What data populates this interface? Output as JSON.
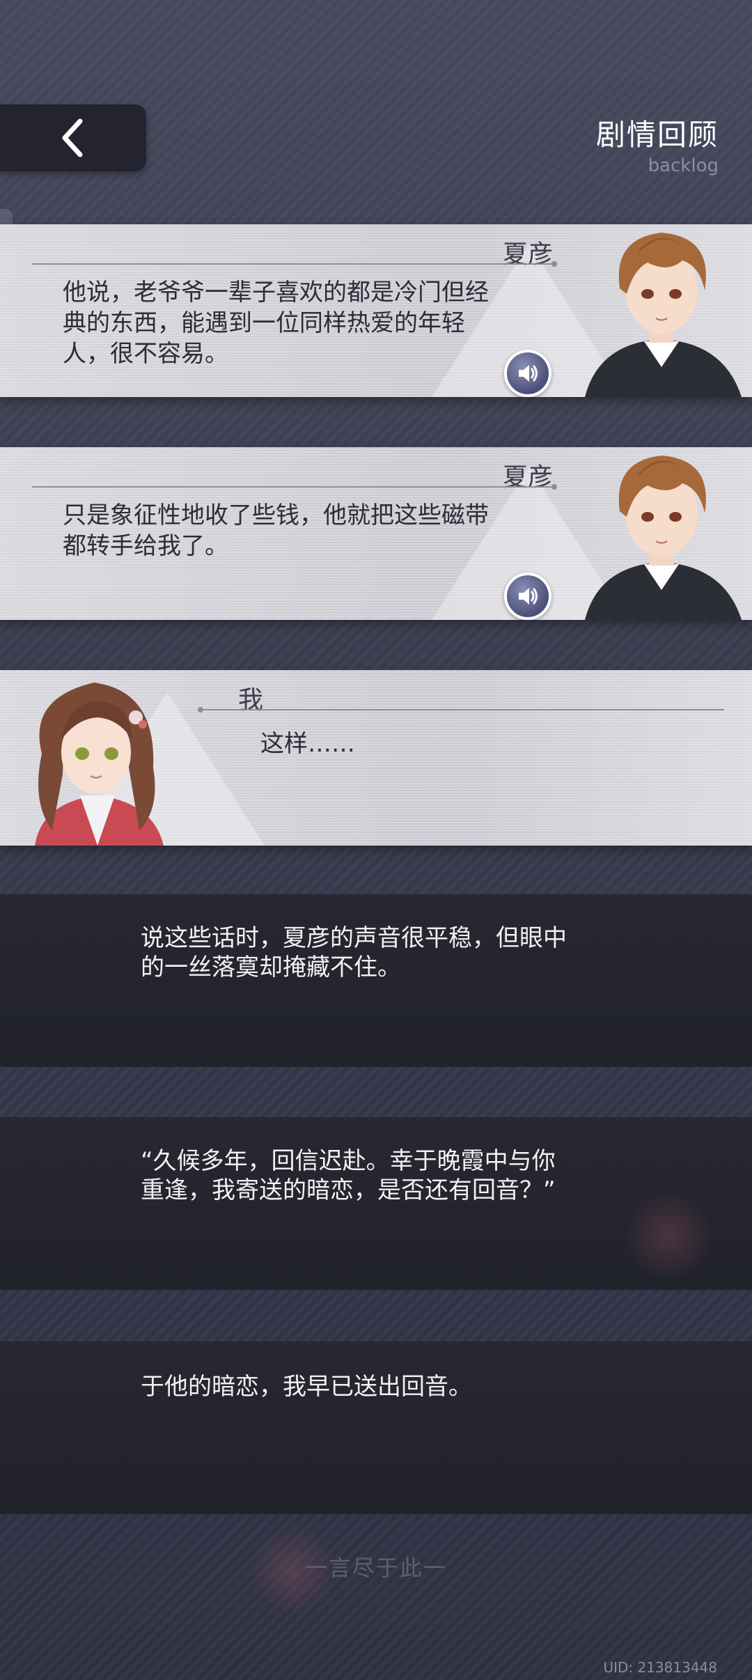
{
  "header": {
    "title": "剧情回顾",
    "subtitle": "backlog",
    "back_icon": "chevron-left-icon"
  },
  "entries": [
    {
      "type": "dialogue",
      "speaker": "夏彦",
      "text_lines": [
        "他说，老爷爷一辈子喜欢的都是冷门但经",
        "典的东西，能遇到一位同样热爱的年轻",
        "人，很不容易。"
      ],
      "has_voice": true,
      "portrait": "male-character-portrait"
    },
    {
      "type": "dialogue",
      "speaker": "夏彦",
      "text_lines": [
        "只是象征性地收了些钱，他就把这些磁带",
        "都转手给我了。"
      ],
      "has_voice": true,
      "portrait": "male-character-portrait"
    },
    {
      "type": "dialogue",
      "speaker": "我",
      "text_lines": [
        "这样……"
      ],
      "has_voice": false,
      "portrait": "female-character-portrait"
    },
    {
      "type": "narration",
      "text_lines": [
        "说这些话时，夏彦的声音很平稳，但眼中",
        "的一丝落寞却掩藏不住。"
      ]
    },
    {
      "type": "narration",
      "text_lines": [
        "“久候多年，回信迟赴。幸于晚霞中与你",
        "重逢，我寄送的暗恋，是否还有回音？”"
      ]
    },
    {
      "type": "narration",
      "text_lines": [
        "于他的暗恋，我早已送出回音。"
      ]
    }
  ],
  "footer": {
    "end_text": "一言尽于此一",
    "uid": "UID: 213813448"
  },
  "colors": {
    "background": "#3d4052",
    "card": "#d0d0d8",
    "narration": "#22232c",
    "voice_button": "#5a5f8a"
  }
}
